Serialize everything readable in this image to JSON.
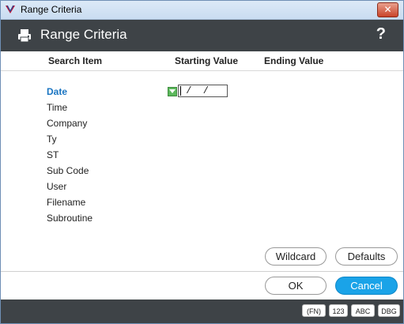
{
  "window": {
    "title": "Range Criteria",
    "close_glyph": "✕"
  },
  "header": {
    "title": "Range Criteria",
    "help": "?",
    "icon": "printer-icon"
  },
  "columns": {
    "search_item": "Search Item",
    "starting_value": "Starting Value",
    "ending_value": "Ending Value"
  },
  "items": [
    "Date",
    "Time",
    "Company",
    "Ty",
    "ST",
    "Sub Code",
    "User",
    "Filename",
    "Subroutine"
  ],
  "date_field": {
    "value": " /  /"
  },
  "buttons": {
    "wildcard": "Wildcard",
    "defaults": "Defaults",
    "ok": "OK",
    "cancel": "Cancel"
  },
  "statusbar": [
    "(FN)",
    "123",
    "ABC",
    "DBG"
  ],
  "colors": {
    "accent": "#1aa3e8",
    "active_item": "#1a75c2",
    "header_bg": "#3e4347"
  }
}
